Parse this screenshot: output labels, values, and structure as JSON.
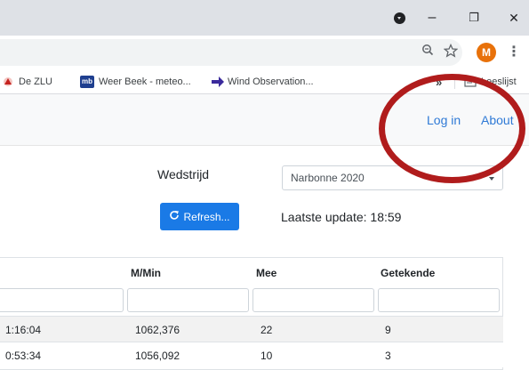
{
  "titlebar": {
    "minimize": "–",
    "maximize": "❐",
    "close": "✕"
  },
  "toolbar": {
    "zoom_icon": "zoom-icon",
    "star_icon": "bookmark-star-icon",
    "avatar_initial": "M",
    "menu_icon": "⋮"
  },
  "bookmarks": {
    "items": [
      {
        "label": "De ZLU",
        "icon": "zlu-icon"
      },
      {
        "label": "Weer Beek - meteo...",
        "icon": "mb-icon",
        "icon_text": "mb"
      },
      {
        "label": "Wind Observation...",
        "icon": "arrow-icon"
      }
    ],
    "overflow": "»",
    "reading_list": "Leeslijst"
  },
  "navbar": {
    "login": "Log in",
    "about": "About"
  },
  "controls": {
    "race_label": "Wedstrijd",
    "race_value": "Narbonne 2020",
    "refresh_label": "Refresh...",
    "last_update": "Laatste update: 18:59"
  },
  "table": {
    "headers": [
      "M/Min",
      "Mee",
      "Getekende"
    ],
    "rows": [
      {
        "time": "1:16:04",
        "speed": "1062,376",
        "mee": "22",
        "getekende": "9"
      },
      {
        "time": "0:53:34",
        "speed": "1056,092",
        "mee": "10",
        "getekende": "3"
      }
    ]
  },
  "colors": {
    "accent": "#1a7ae6",
    "annotation": "#b01c1c",
    "avatar": "#e8710a"
  }
}
